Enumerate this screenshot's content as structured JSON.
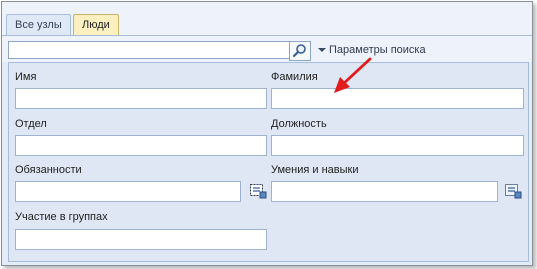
{
  "tabs": [
    {
      "label": "Все узлы",
      "active": false
    },
    {
      "label": "Люди",
      "active": true
    }
  ],
  "search": {
    "value": "",
    "placeholder": "",
    "options_label": "Параметры поиска"
  },
  "fields": {
    "first_name": {
      "label": "Имя",
      "value": ""
    },
    "last_name": {
      "label": "Фамилия",
      "value": ""
    },
    "department": {
      "label": "Отдел",
      "value": ""
    },
    "position": {
      "label": "Должность",
      "value": ""
    },
    "duties": {
      "label": "Обязанности",
      "value": ""
    },
    "skills": {
      "label": "Умения и навыки",
      "value": ""
    },
    "groups": {
      "label": "Участие в группах",
      "value": ""
    }
  },
  "icons": {
    "search": "magnifier-icon",
    "duties_picker": "list-picker-icon",
    "skills_picker": "list-picker-icon",
    "annotation": "red-arrow-icon"
  },
  "colors": {
    "active_tab": "#fdf0c0",
    "panel": "#dfe7f4",
    "annotation_arrow": "#e01b1b"
  }
}
